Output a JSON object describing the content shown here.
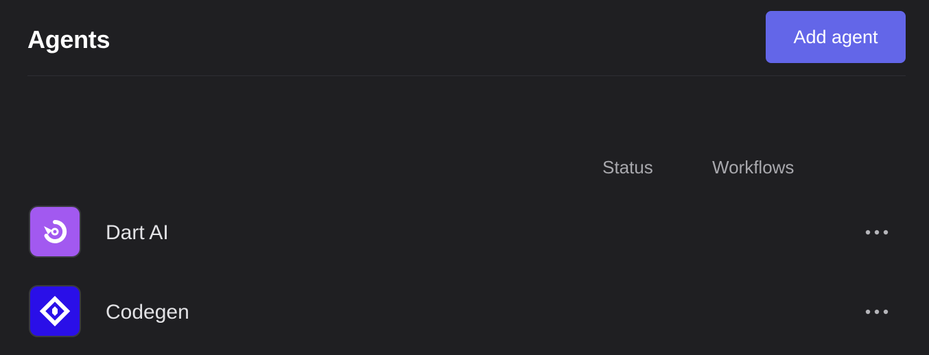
{
  "header": {
    "title": "Agents",
    "add_button_label": "Add agent"
  },
  "columns": {
    "status": "Status",
    "workflows": "Workflows"
  },
  "agents": [
    {
      "name": "Dart AI",
      "logo_icon": "dart-ai-logo-icon",
      "logo_color": "#a259f0"
    },
    {
      "name": "Codegen",
      "logo_icon": "codegen-logo-icon",
      "logo_color": "#2a0fe8"
    }
  ],
  "colors": {
    "background": "#1f1f22",
    "accent": "#6366e8"
  }
}
